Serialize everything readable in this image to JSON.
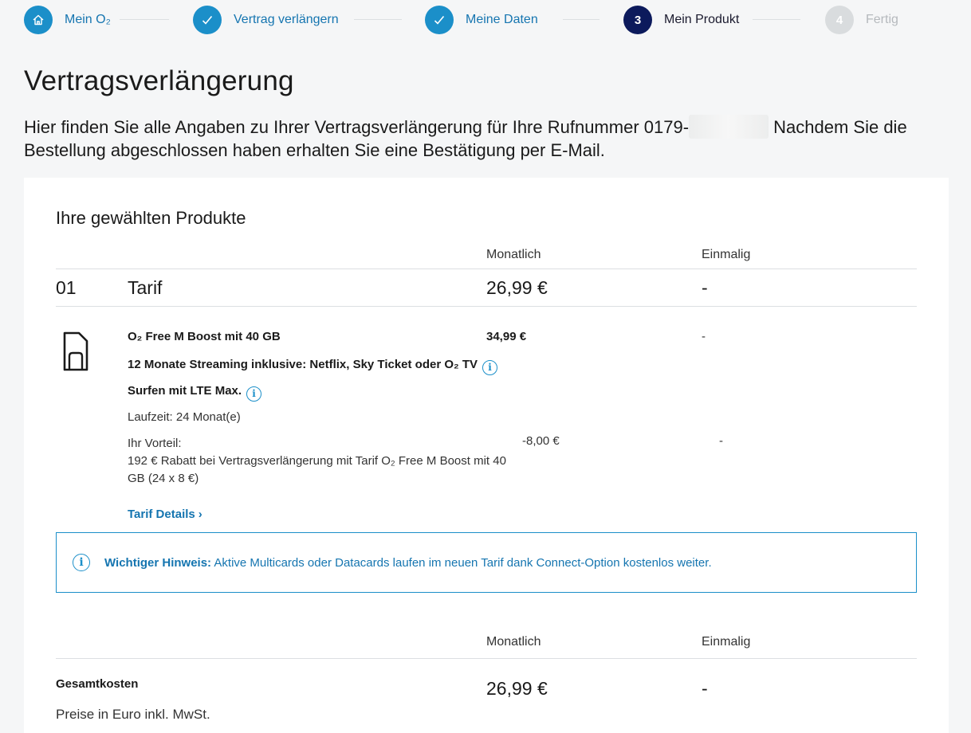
{
  "stepper": {
    "steps": [
      {
        "label": "Mein O₂",
        "state": "done",
        "icon": "home-icon"
      },
      {
        "label": "Vertrag verlängern",
        "state": "done",
        "icon": "check-icon"
      },
      {
        "label": "Meine Daten",
        "state": "done",
        "icon": "check-icon"
      },
      {
        "number": "3",
        "label": "Mein Produkt",
        "state": "current"
      },
      {
        "number": "4",
        "label": "Fertig",
        "state": "future"
      }
    ]
  },
  "page": {
    "title": "Vertragsverlängerung",
    "intro_before": "Hier finden Sie alle Angaben zu Ihrer Vertragsverlängerung für Ihre Rufnummer 0179-",
    "intro_after": " Nachdem Sie die Bestellung abgeschlossen haben erhalten Sie eine Bestätigung per E-Mail."
  },
  "products": {
    "title": "Ihre gewählten Produkte",
    "col_monthly": "Monatlich",
    "col_once": "Einmalig",
    "row": {
      "number": "01",
      "name": "Tarif",
      "monthly": "26,99 €",
      "once": "-"
    },
    "tariff": {
      "name": "O₂ Free M Boost mit 40 GB",
      "price_monthly": "34,99 €",
      "price_once": "-",
      "feature_streaming": "12 Monate Streaming inklusive: Netflix, Sky Ticket oder O₂ TV",
      "feature_lte": "Surfen mit LTE Max.",
      "duration": "Laufzeit: 24 Monat(e)",
      "advantage_label": "Ihr Vorteil:",
      "advantage_text": "192 € Rabatt bei Vertragsverlängerung mit Tarif O₂ Free M Boost mit 40 GB (24 x 8 €)",
      "advantage_monthly": "-8,00 €",
      "advantage_once": "-",
      "details_link": "Tarif Details",
      "details_chevron": "›"
    },
    "notice": {
      "label": "Wichtiger Hinweis:",
      "text": " Aktive Multicards oder Datacards laufen im neuen Tarif dank Connect-Option kostenlos weiter."
    }
  },
  "totals": {
    "col_monthly": "Monatlich",
    "col_once": "Einmalig",
    "label": "Gesamtkosten",
    "monthly": "26,99 €",
    "once": "-",
    "vat_note": "Preise in Euro inkl. MwSt."
  },
  "icons": {
    "sim": "sim-card-icon",
    "info": "info-icon",
    "info_glyph": "i"
  },
  "colors": {
    "accent": "#1b8fc9",
    "current_step": "#0c1a5c",
    "link": "#1575b0"
  }
}
